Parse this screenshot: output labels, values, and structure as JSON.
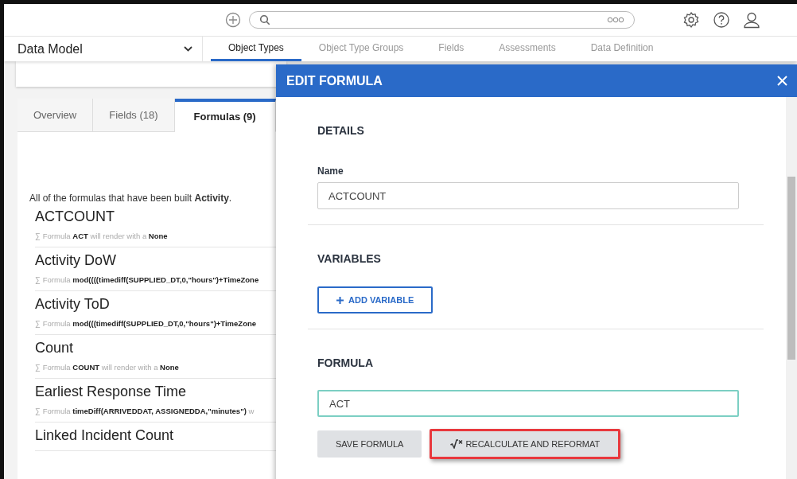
{
  "nav": {
    "title": "Data Model",
    "tabs": [
      {
        "label": "Object Types",
        "selected": true
      },
      {
        "label": "Object Type Groups",
        "selected": false
      },
      {
        "label": "Fields",
        "selected": false
      },
      {
        "label": "Assessments",
        "selected": false
      },
      {
        "label": "Data Definition",
        "selected": false
      }
    ]
  },
  "left": {
    "tabs": [
      {
        "label": "Overview",
        "selected": false
      },
      {
        "label": "Fields (18)",
        "selected": false
      },
      {
        "label": "Formulas (9)",
        "selected": true
      }
    ],
    "intro": "All of the formulas that have been built **Activity**.",
    "formulas": [
      {
        "name": "ACTCOUNT",
        "description": "Formula **ACT** will render with a **None**"
      },
      {
        "name": "Activity DoW",
        "description": "Formula **mod((((timediff(SUPPLIED_DT,0,\"hours\")+TimeZone**"
      },
      {
        "name": "Activity ToD",
        "description": "Formula **mod(((timediff(SUPPLIED_DT,0,\"hours\")+TimeZone**"
      },
      {
        "name": "Count",
        "description": "Formula **COUNT** will render with a **None**"
      },
      {
        "name": "Earliest Response Time",
        "description": "Formula **timeDiff(ARRIVEDDAT, ASSIGNEDDA,\"minutes\")** w"
      },
      {
        "name": "Linked Incident Count"
      }
    ],
    "formula_symbol": "∑"
  },
  "modal": {
    "title": "EDIT FORMULA",
    "details_heading": "DETAILS",
    "name_label": "Name",
    "name_value": "ACTCOUNT",
    "variables_heading": "VARIABLES",
    "add_variable": "ADD VARIABLE",
    "formula_heading": "FORMULA",
    "formula_value": "ACT",
    "formula_focused": true,
    "buttons": [
      {
        "label": "SAVE FORMULA",
        "kind": "plain",
        "highlighted": false
      },
      {
        "label": "RECALCULATE AND REFORMAT",
        "kind": "recalculate",
        "highlighted": true
      }
    ]
  }
}
